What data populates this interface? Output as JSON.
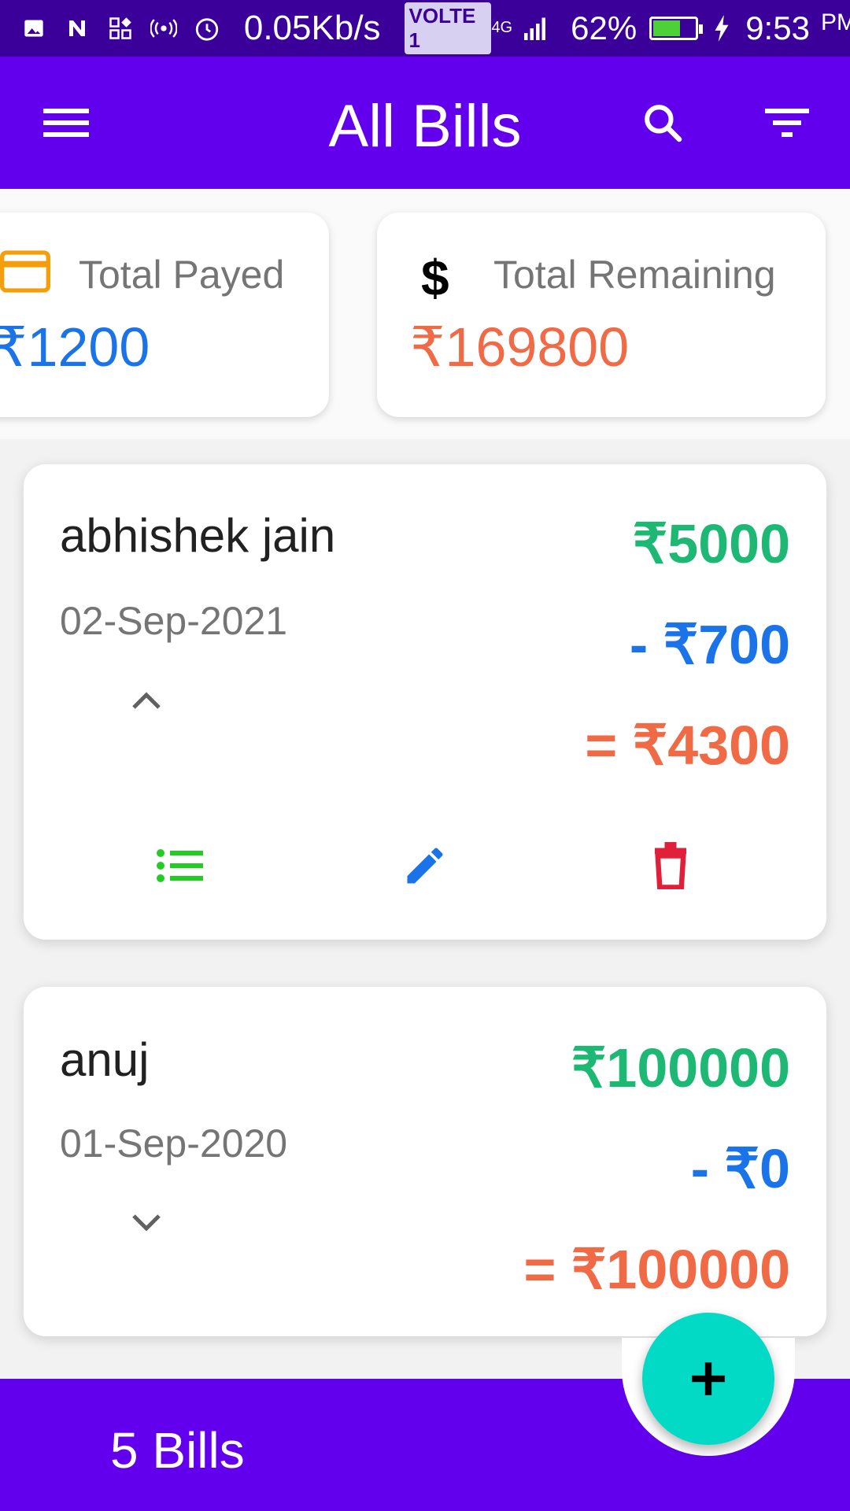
{
  "status_bar": {
    "network_speed": "0.05Kb/s",
    "volte": "VOLTE 1",
    "network_type": "4G",
    "battery_percent": "62%",
    "battery_level": 0.62,
    "time": "9:53",
    "ampm": "PM"
  },
  "app_bar": {
    "title": "All Bills",
    "icons": [
      "menu-icon",
      "search-icon",
      "filter-icon"
    ]
  },
  "summary": {
    "paid": {
      "label": "Total Payed",
      "value": "₹1200",
      "icon": "credit-card-icon",
      "color": "#1a73e8"
    },
    "remaining": {
      "label": "Total Remaining",
      "value": "₹169800",
      "icon": "dollar-icon",
      "color": "#ef6a45"
    }
  },
  "bills": [
    {
      "name": "abhishek jain",
      "date": "02-Sep-2021",
      "total": "₹5000",
      "paid": "- ₹700",
      "remaining": "= ₹4300",
      "expanded": true
    },
    {
      "name": "anuj",
      "date": "01-Sep-2020",
      "total": "₹100000",
      "paid": "- ₹0",
      "remaining": "= ₹100000",
      "expanded": false
    }
  ],
  "bottom_bar": {
    "count_label": "5 Bills"
  },
  "colors": {
    "primary": "#6200ee",
    "status_bar": "#3a0099",
    "fab": "#03dac6",
    "total": "#1cb874",
    "paid": "#1a73e8",
    "remaining": "#ef6a45",
    "list_action": "#22cc22",
    "edit_action": "#1a73e8",
    "delete_action": "#e0203a"
  }
}
